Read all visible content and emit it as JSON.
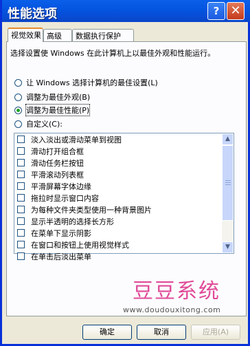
{
  "window": {
    "title": "性能选项"
  },
  "titlebar": {
    "help_label": "?",
    "close_label": "✕"
  },
  "tabs": [
    {
      "label": "视觉效果",
      "active": true
    },
    {
      "label": "高级",
      "active": false
    },
    {
      "label": "数据执行保护",
      "active": false
    }
  ],
  "description": "选择设置使 Windows 在此计算机上以最佳外观和性能运行。",
  "options": [
    {
      "label": "让 Windows 选择计算机的最佳设置(L)",
      "selected": false
    },
    {
      "label": "调整为最佳外观(B)",
      "selected": false
    },
    {
      "label": "调整为最佳性能(P)",
      "selected": true
    },
    {
      "label": "自定义(C):",
      "selected": false
    }
  ],
  "effects": [
    "淡入淡出或滑动菜单到视图",
    "滑动打开组合框",
    "滑动任务栏按钮",
    "平滑滚动列表框",
    "平滑屏幕字体边缘",
    "拖拉时显示窗口内容",
    "为每种文件夹类型使用一种背景图片",
    "显示半透明的选择长方形",
    "在菜单下显示阴影",
    "在窗口和按钮上使用视觉样式",
    "在单击后淡出菜单"
  ],
  "watermark": {
    "text": "豆豆系统",
    "url": "www.doudouxitong.com"
  },
  "buttons": {
    "ok": "确定",
    "cancel": "取消",
    "apply": "应用(A)"
  },
  "colors": {
    "title_bar": "#0454e0",
    "selection_dot": "#21a121",
    "tab_highlight": "#e68b2c"
  }
}
